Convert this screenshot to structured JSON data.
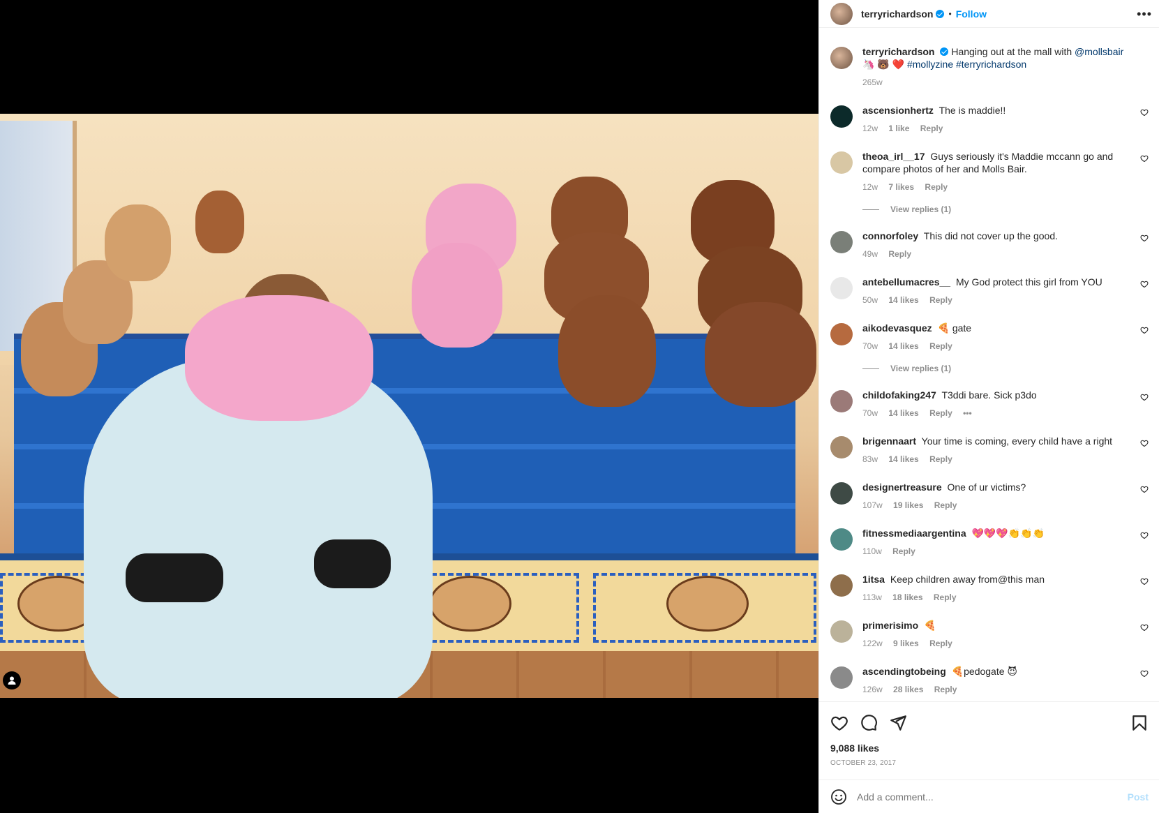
{
  "post": {
    "author": "terryrichardson",
    "follow_label": "Follow",
    "dot": "•",
    "more_label": "•••",
    "caption_text": "Hanging out at the mall with",
    "caption_mention": "@mollsbair",
    "caption_emojis": "🦄 🐻 ❤️",
    "caption_hashtags": "#mollyzine #terryrichardson",
    "caption_time": "265w",
    "likes": "9,088 likes",
    "date": "OCTOBER 23, 2017"
  },
  "comments": [
    {
      "user": "ascensionhertz",
      "text": "The is maddie!!",
      "time": "12w",
      "likes": "1 like",
      "reply": "Reply",
      "avatar_color": "#0c2a2a"
    },
    {
      "user": "theoa_irl__17",
      "text": "Guys seriously it's Maddie mccann go and compare photos of her and Molls Bair.",
      "time": "12w",
      "likes": "7 likes",
      "reply": "Reply",
      "view_replies": "View replies (1)",
      "avatar_color": "#d8c7a4"
    },
    {
      "user": "connorfoley",
      "text": "This did not cover up the good.",
      "time": "49w",
      "likes": "",
      "reply": "Reply",
      "avatar_color": "#7a7f78"
    },
    {
      "user": "antebellumacres__",
      "text": "My God protect this girl from YOU",
      "time": "50w",
      "likes": "14 likes",
      "reply": "Reply",
      "avatar_color": "#e8e8e8"
    },
    {
      "user": "aikodevasquez",
      "text": "🍕 gate",
      "time": "70w",
      "likes": "14 likes",
      "reply": "Reply",
      "view_replies": "View replies (1)",
      "avatar_color": "#b66a3f"
    },
    {
      "user": "childofaking247",
      "text": "T3ddi bare. Sick p3do",
      "time": "70w",
      "likes": "14 likes",
      "reply": "Reply",
      "extra": "•••",
      "avatar_color": "#9b7a78"
    },
    {
      "user": "brigennaart",
      "text": "Your time is coming, every child have a right",
      "time": "83w",
      "likes": "14 likes",
      "reply": "Reply",
      "avatar_color": "#a78b6d"
    },
    {
      "user": "designertreasure",
      "text": "One of ur victims?",
      "time": "107w",
      "likes": "19 likes",
      "reply": "Reply",
      "avatar_color": "#3e4a45"
    },
    {
      "user": "fitnessmediaargentina",
      "text": "💖💖💖👏👏👏",
      "time": "110w",
      "likes": "",
      "reply": "Reply",
      "avatar_color": "#4e8a86"
    },
    {
      "user": "1itsa",
      "text": "Keep children away from@this man",
      "time": "113w",
      "likes": "18 likes",
      "reply": "Reply",
      "avatar_color": "#8e6e4b"
    },
    {
      "user": "primerisimo",
      "text": "🍕",
      "time": "122w",
      "likes": "9 likes",
      "reply": "Reply",
      "avatar_color": "#bbb29a"
    },
    {
      "user": "ascendingtobeing",
      "text": "🍕pedogate 😈",
      "time": "126w",
      "likes": "28 likes",
      "reply": "Reply",
      "avatar_color": "#8a8a8a"
    }
  ],
  "add_comment": {
    "placeholder": "Add a comment...",
    "post_label": "Post"
  },
  "icons": [
    "heart-icon",
    "comment-icon",
    "share-icon",
    "bookmark-icon",
    "emoji-icon",
    "more-icon",
    "verified-icon",
    "user-tag-icon"
  ]
}
